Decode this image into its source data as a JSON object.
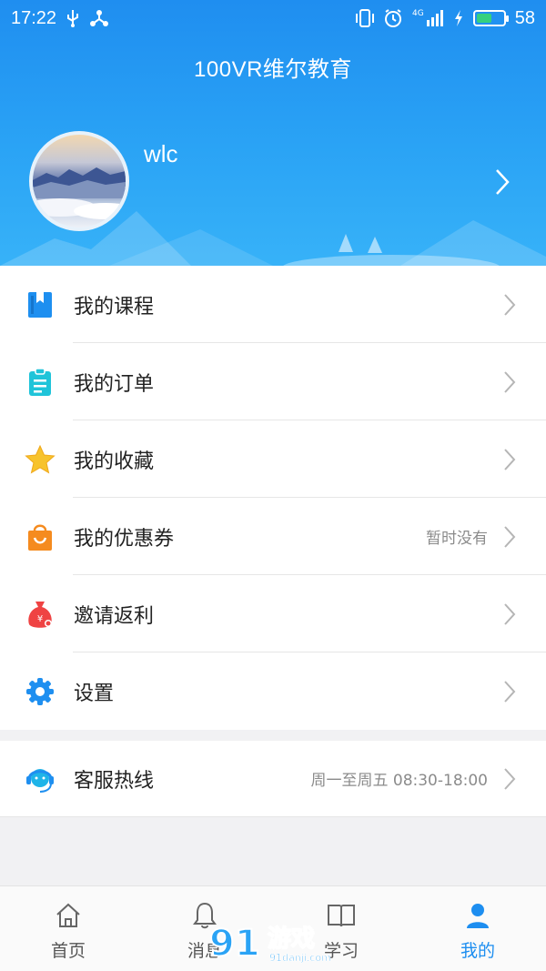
{
  "status_bar": {
    "time": "17:22",
    "network": "4G",
    "battery_level": "58",
    "battery_fraction": 0.58,
    "icons": [
      "usb-icon",
      "share-icon",
      "vibrate-icon",
      "alarm-icon",
      "signal-icon",
      "charging-icon",
      "battery-icon"
    ]
  },
  "header": {
    "title": "100VR维尔教育"
  },
  "profile": {
    "username": "wlc"
  },
  "menu": {
    "items": [
      {
        "label": "我的课程",
        "extra": "",
        "icon": "book-icon",
        "color": "#1e8ff0"
      },
      {
        "label": "我的订单",
        "extra": "",
        "icon": "clipboard-icon",
        "color": "#1fc4d9"
      },
      {
        "label": "我的收藏",
        "extra": "",
        "icon": "star-icon",
        "color": "#f7c32c"
      },
      {
        "label": "我的优惠券",
        "extra": "暂时没有",
        "icon": "shopping-bag-icon",
        "color": "#f58b1f"
      },
      {
        "label": "邀请返利",
        "extra": "",
        "icon": "money-bag-icon",
        "color": "#ef4343"
      },
      {
        "label": "设置",
        "extra": "",
        "icon": "gear-icon",
        "color": "#1e8ff0"
      }
    ]
  },
  "service": {
    "label": "客服热线",
    "hours": "周一至周五 08:30-18:00",
    "icon": "headset-icon"
  },
  "tabbar": {
    "tabs": [
      {
        "label": "首页",
        "icon": "home-icon"
      },
      {
        "label": "消息",
        "icon": "bell-icon"
      },
      {
        "label": "学习",
        "icon": "open-book-icon"
      },
      {
        "label": "我的",
        "icon": "user-icon"
      }
    ],
    "active_color": "#1d8ef0"
  },
  "watermark": {
    "brand": "游戏",
    "url": "91danji.com"
  }
}
